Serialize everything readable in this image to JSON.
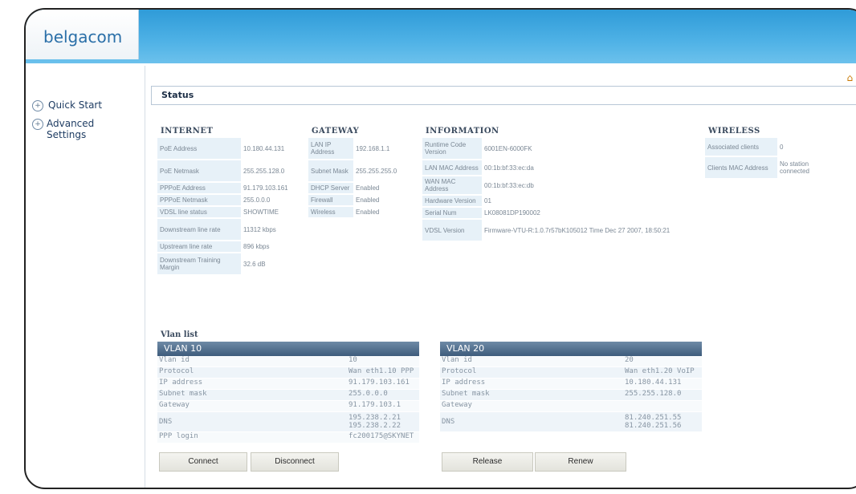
{
  "brand": {
    "logo": "belgacom"
  },
  "top_icons": {
    "home": "home-icon",
    "logout": "logout-icon",
    "home_glyph": "⌂",
    "logout_glyph": "⇥"
  },
  "sidebar": {
    "items": [
      {
        "label": "Quick Start",
        "icon": "plus-circle-icon"
      },
      {
        "label": "Advanced Settings",
        "icon": "plus-circle-icon"
      }
    ]
  },
  "status": {
    "title": "Status"
  },
  "internet": {
    "title": "INTERNET",
    "rows": [
      {
        "k": "PoE Address",
        "v": "10.180.44.131"
      },
      {
        "k": "PoE Netmask",
        "v": "255.255.128.0"
      },
      {
        "k": "PPPoE Address",
        "v": "91.179.103.161"
      },
      {
        "k": "PPPoE Netmask",
        "v": "255.0.0.0"
      },
      {
        "k": "VDSL line status",
        "v": "SHOWTIME"
      },
      {
        "k": "Downstream line rate",
        "v": "11312 kbps"
      },
      {
        "k": "Upstream line rate",
        "v": "896 kbps"
      },
      {
        "k": "Downstream Training Margin",
        "v": "32.6 dB"
      }
    ]
  },
  "gateway": {
    "title": "GATEWAY",
    "rows": [
      {
        "k": "LAN IP Address",
        "v": "192.168.1.1"
      },
      {
        "k": "Subnet Mask",
        "v": "255.255.255.0"
      },
      {
        "k": "DHCP Server",
        "v": "Enabled"
      },
      {
        "k": "Firewall",
        "v": "Enabled"
      },
      {
        "k": "Wireless",
        "v": "Enabled"
      }
    ]
  },
  "information": {
    "title": "INFORMATION",
    "rows": [
      {
        "k": "Runtime Code Version",
        "v": "6001EN-6000FK"
      },
      {
        "k": "LAN MAC Address",
        "v": "00:1b:bf:33:ec:da"
      },
      {
        "k": "WAN MAC Address",
        "v": "00:1b:bf:33:ec:db"
      },
      {
        "k": "Hardware Version",
        "v": "01"
      },
      {
        "k": "Serial Num",
        "v": "LK08081DP190002"
      },
      {
        "k": "VDSL Version",
        "v": "Firmware-VTU-R:1.0.7r57bK105012 Time Dec 27 2007, 18:50:21"
      }
    ]
  },
  "wireless": {
    "title": "WIRELESS",
    "rows": [
      {
        "k": "Associated clients",
        "v": "0"
      },
      {
        "k": "Clients MAC Address",
        "v": "No station connected"
      }
    ]
  },
  "vlan": {
    "title": "Vlan list",
    "left": {
      "name": "VLAN 10",
      "rows": [
        {
          "k": "Vlan id",
          "v": "10"
        },
        {
          "k": "Protocol",
          "v": "Wan eth1.10 PPP"
        },
        {
          "k": "IP address",
          "v": "91.179.103.161"
        },
        {
          "k": "Subnet mask",
          "v": "255.0.0.0"
        },
        {
          "k": "Gateway",
          "v": "91.179.103.1"
        },
        {
          "k": "DNS",
          "v": "195.238.2.21\n195.238.2.22"
        },
        {
          "k": "PPP login",
          "v": "fc200175@SKYNET"
        }
      ]
    },
    "right": {
      "name": "VLAN 20",
      "rows": [
        {
          "k": "Vlan id",
          "v": "20"
        },
        {
          "k": "Protocol",
          "v": "Wan eth1.20 VoIP"
        },
        {
          "k": "IP address",
          "v": "10.180.44.131"
        },
        {
          "k": "Subnet mask",
          "v": "255.255.128.0"
        },
        {
          "k": "Gateway",
          "v": ""
        },
        {
          "k": "DNS",
          "v": "81.240.251.55\n81.240.251.56"
        }
      ]
    }
  },
  "buttons": {
    "connect": "Connect",
    "disconnect": "Disconnect",
    "release": "Release",
    "renew": "Renew"
  }
}
